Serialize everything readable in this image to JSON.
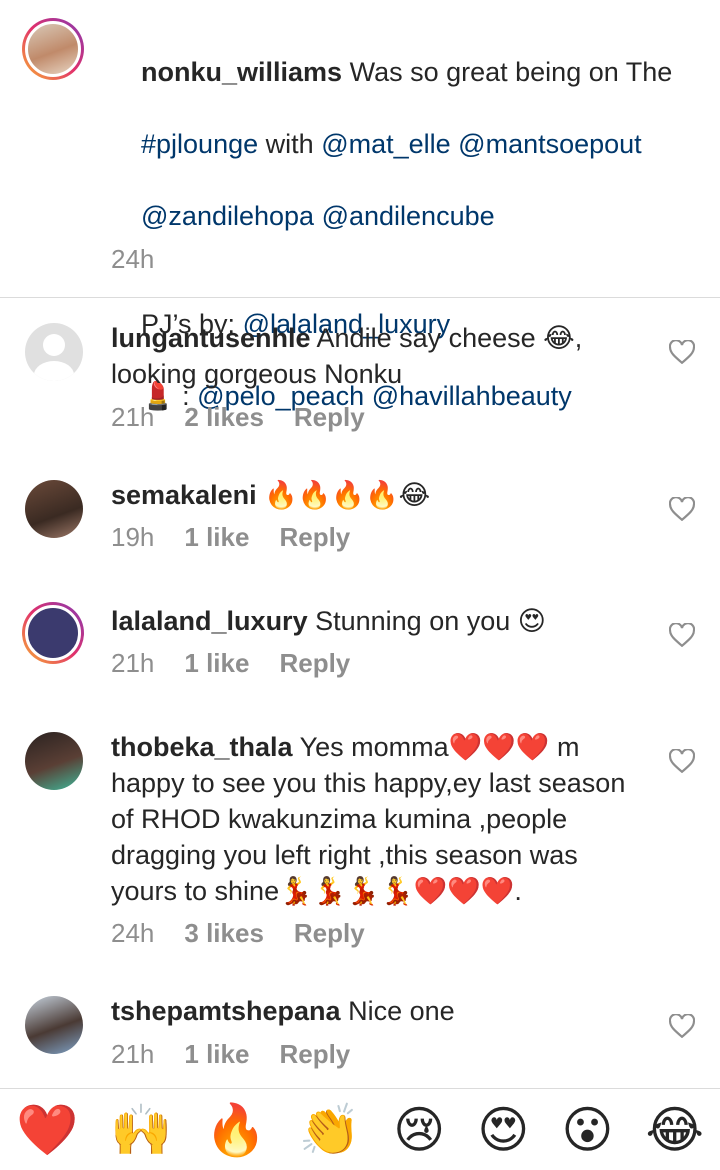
{
  "caption": {
    "username": "nonku_williams",
    "line1": "Was so great being on The",
    "m_pjlounge": "#pjlounge",
    "with": "with",
    "m_mat": "@mat_elle",
    "m_mantso": "@mantsoepout",
    "m_zandile": "@zandilehopa",
    "m_andile": "@andilencube",
    "pj_by": "PJ’s by:",
    "m_lalaland": "@lalaland_luxury",
    "lipstick": "💄 :",
    "m_pelo": "@pelo_peach",
    "m_havillah": "@havillahbeauty",
    "time": "24h"
  },
  "comments": [
    {
      "username": "lungantusenhle",
      "text": "Andile say cheese 😂, looking gorgeous Nonku",
      "time": "21h",
      "likes": "2 likes",
      "reply": "Reply"
    },
    {
      "username": "semakaleni",
      "text": "🔥🔥🔥🔥😂",
      "time": "19h",
      "likes": "1 like",
      "reply": "Reply"
    },
    {
      "username": "lalaland_luxury",
      "text": "Stunning on you 😍",
      "time": "21h",
      "likes": "1 like",
      "reply": "Reply"
    },
    {
      "username": "thobeka_thala",
      "text": "Yes momma❤️❤️❤️ m happy to see you this happy,ey last season of RHOD kwakunzima kumina ,people dragging you left right ,this season was yours to shine💃💃💃💃❤️❤️❤️.",
      "time": "24h",
      "likes": "3 likes",
      "reply": "Reply"
    },
    {
      "username": "tshepamtshepana",
      "text": "Nice one",
      "time": "21h",
      "likes": "1 like",
      "reply": "Reply"
    }
  ],
  "reactions": [
    "❤️",
    "🙌",
    "🔥",
    "👏",
    "😢",
    "😍",
    "😮",
    "😂"
  ],
  "colors": {
    "mention": "#00376b",
    "meta": "#8e8e8e",
    "divider": "#dbdbdb"
  }
}
